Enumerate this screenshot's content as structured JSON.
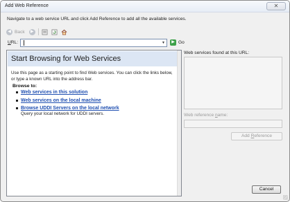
{
  "window": {
    "title": "Add Web Reference",
    "close_glyph": "✕"
  },
  "instruction": "Navigate to a web service URL and click Add Reference to add all the available services.",
  "toolbar": {
    "back_label": "Back",
    "back_glyph": "◀",
    "forward_glyph": "▶"
  },
  "url": {
    "label_prefix": "",
    "label_access_key": "U",
    "label_rest": "RL:",
    "value": "",
    "dropdown_glyph": "▼",
    "go_label": "Go",
    "go_glyph": "▶"
  },
  "browser": {
    "heading": "Start Browsing for Web Services",
    "intro": "Use this page as a starting point to find Web services. You can click the links below, or type a known URL into the address bar.",
    "browse_to": "Browse to:",
    "links": [
      {
        "label": "Web services in this solution"
      },
      {
        "label": "Web services on the local machine"
      },
      {
        "label": "Browse UDDI Servers on the local network",
        "description": "Query your local network for UDDI servers."
      }
    ]
  },
  "right": {
    "found_label": "Web services found at this URL:",
    "ref_label_prefix": "Web reference ",
    "ref_label_access_key": "n",
    "ref_label_rest": "ame:",
    "ref_value": "",
    "add_prefix": "Add ",
    "add_access_key": "R",
    "add_rest": "eference"
  },
  "footer": {
    "cancel_label": "Cancel"
  },
  "colors": {
    "accent": "#1f4fb1",
    "header_bg": "#dce6f4",
    "go_green": "#3da14a"
  }
}
